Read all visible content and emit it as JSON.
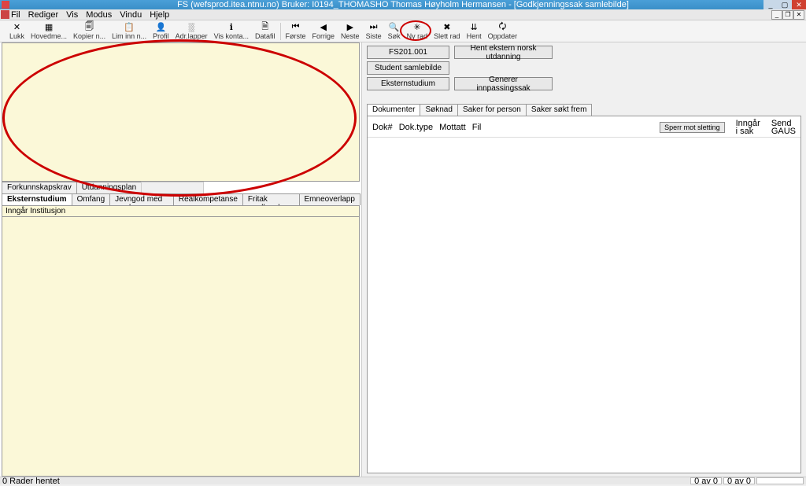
{
  "title": "FS (wefsprod.itea.ntnu.no) Bruker: I0194_THOMASHO Thomas Høyholm Hermansen - [Godkjenningssak samlebilde]",
  "menu": {
    "fil": "Fil",
    "rediger": "Rediger",
    "vis": "Vis",
    "modus": "Modus",
    "vindu": "Vindu",
    "hjelp": "Hjelp"
  },
  "toolbar": [
    {
      "label": "Lukk",
      "icon": "✕"
    },
    {
      "label": "Hovedme...",
      "icon": "▦"
    },
    {
      "label": "Kopier n...",
      "icon": "🗐"
    },
    {
      "label": "Lim inn n...",
      "icon": "📋"
    },
    {
      "label": "Profil",
      "icon": "👤"
    },
    {
      "label": "Adr.lapper",
      "icon": "░"
    },
    {
      "label": "Vis konta...",
      "icon": "ℹ"
    },
    {
      "label": "Datafil",
      "icon": "🗎"
    },
    {
      "label": "Første",
      "icon": "⏮"
    },
    {
      "label": "Forrige",
      "icon": "◀"
    },
    {
      "label": "Neste",
      "icon": "▶"
    },
    {
      "label": "Siste",
      "icon": "⏭"
    },
    {
      "label": "Søk",
      "icon": "🔍"
    },
    {
      "label": "Ny rad",
      "icon": "✳",
      "highlight": true
    },
    {
      "label": "Slett rad",
      "icon": "✖"
    },
    {
      "label": "Hent",
      "icon": "⇊"
    },
    {
      "label": "Oppdater",
      "icon": "🗘"
    }
  ],
  "right_buttons": {
    "fs_id": "FS201.001",
    "hent_ekstern": "Hent ekstern norsk utdanning",
    "student_samlebilde": "Student samlebilde",
    "eksternstudium": "Eksternstudium",
    "generer": "Generer innpassingssak"
  },
  "left_tabs_row1": [
    {
      "label": "Forkunnskapskrav"
    },
    {
      "label": "Utdanningsplan"
    },
    {
      "label": "",
      "ghost": true
    }
  ],
  "left_tabs_row2": [
    {
      "label": "Eksternstudium",
      "active": true
    },
    {
      "label": "Omfang"
    },
    {
      "label": "Jevngod med grad"
    },
    {
      "label": "Realkompetanse"
    },
    {
      "label": "Fritak vurdkomb"
    },
    {
      "label": "Emneoverlapp"
    }
  ],
  "sub_header": "Inngår Institusjon",
  "doc_tabs": [
    {
      "label": "Dokumenter",
      "active": true
    },
    {
      "label": "Søknad"
    },
    {
      "label": "Saker for person"
    },
    {
      "label": "Saker søkt frem"
    }
  ],
  "doc_cols": {
    "dok": "Dok#",
    "doktype": "Dok.type",
    "mottatt": "Mottatt",
    "fil": "Fil"
  },
  "sperr_btn": "Sperr mot sletting",
  "ing": {
    "l1": "Inngår",
    "l2": "i sak",
    "l3": "Send",
    "l4": "GAUS"
  },
  "status": {
    "left": "0 Rader hentet",
    "c1": "0 av 0",
    "c2": "0 av 0"
  }
}
